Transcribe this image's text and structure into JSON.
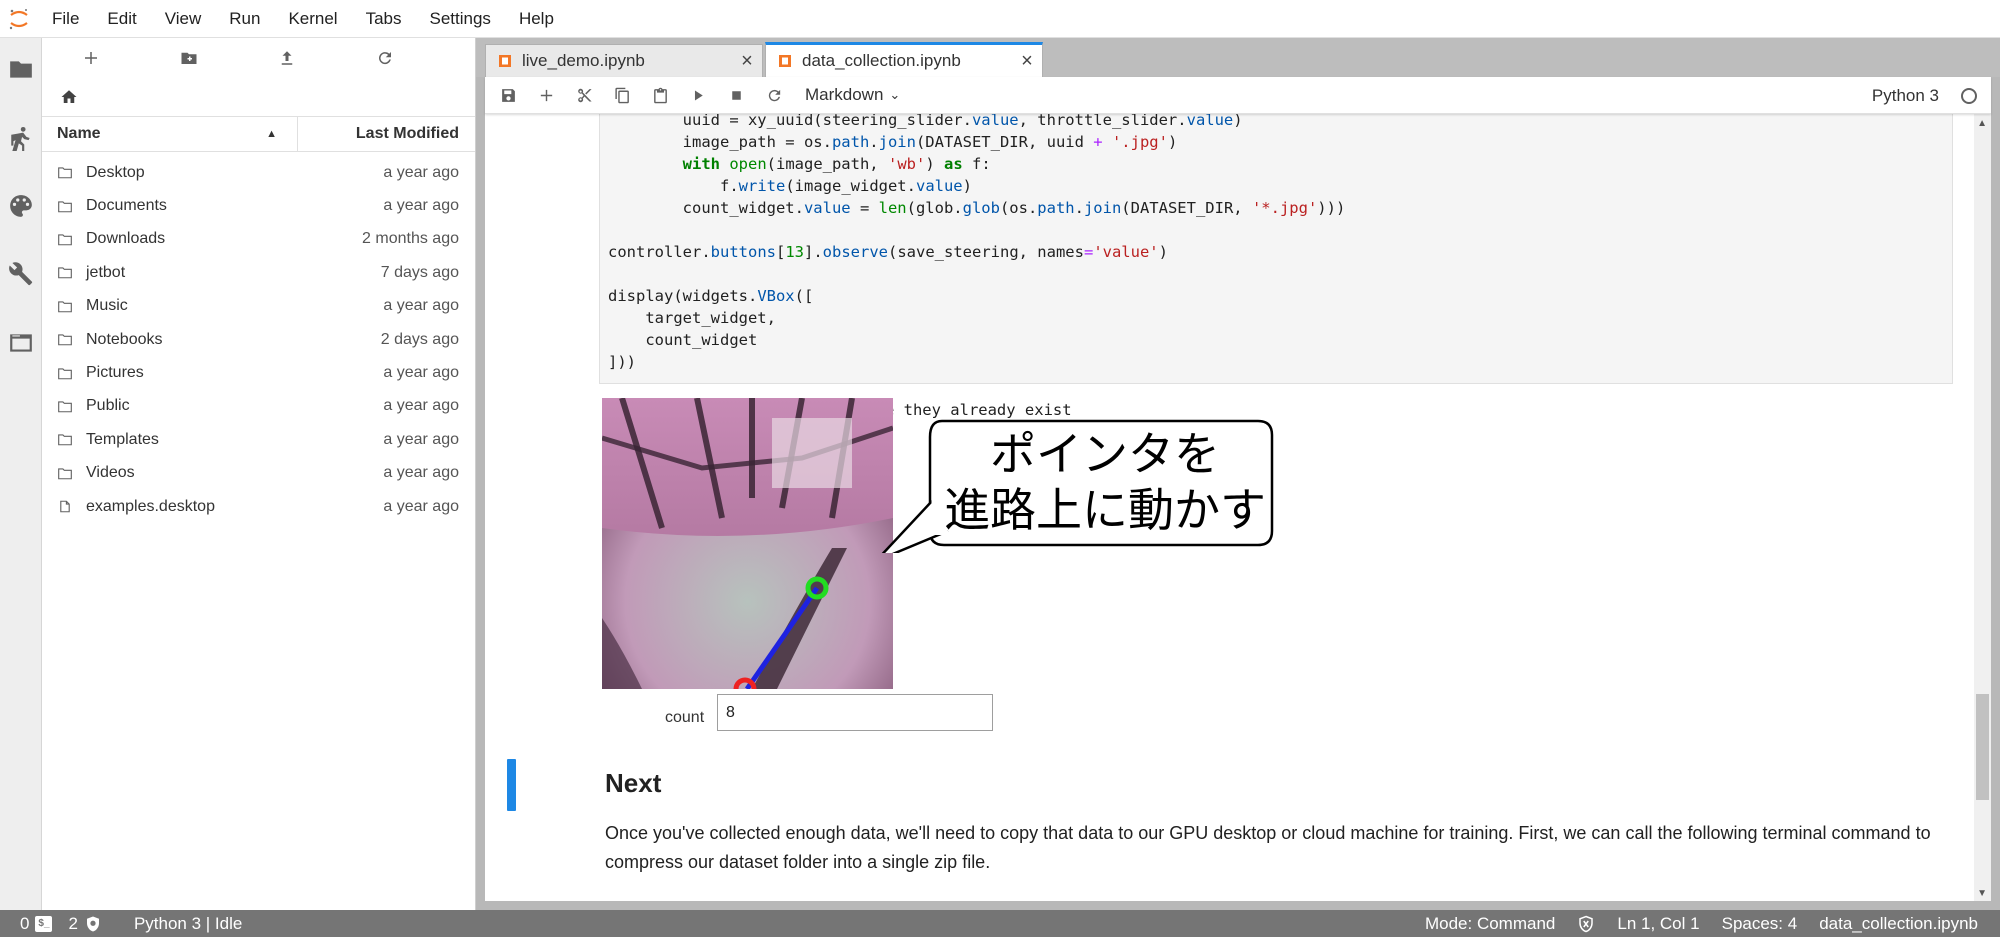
{
  "menu": [
    "File",
    "Edit",
    "View",
    "Run",
    "Kernel",
    "Tabs",
    "Settings",
    "Help"
  ],
  "file_browser": {
    "columns": {
      "name": "Name",
      "modified": "Last Modified"
    },
    "items": [
      {
        "name": "Desktop",
        "modified": "a year ago",
        "type": "folder"
      },
      {
        "name": "Documents",
        "modified": "a year ago",
        "type": "folder"
      },
      {
        "name": "Downloads",
        "modified": "2 months ago",
        "type": "folder"
      },
      {
        "name": "jetbot",
        "modified": "7 days ago",
        "type": "folder"
      },
      {
        "name": "Music",
        "modified": "a year ago",
        "type": "folder"
      },
      {
        "name": "Notebooks",
        "modified": "2 days ago",
        "type": "folder"
      },
      {
        "name": "Pictures",
        "modified": "a year ago",
        "type": "folder"
      },
      {
        "name": "Public",
        "modified": "a year ago",
        "type": "folder"
      },
      {
        "name": "Templates",
        "modified": "a year ago",
        "type": "folder"
      },
      {
        "name": "Videos",
        "modified": "a year ago",
        "type": "folder"
      },
      {
        "name": "examples.desktop",
        "modified": "a year ago",
        "type": "file"
      }
    ]
  },
  "tabs": [
    {
      "label": "live_demo.ipynb",
      "active": false
    },
    {
      "label": "data_collection.ipynb",
      "active": true
    }
  ],
  "notebook_toolbar": {
    "cell_type": "Markdown",
    "kernel": "Python 3"
  },
  "code_cell": {
    "lines": [
      "        uuid = xy_uuid(steering_slider.value, throttle_slider.value)",
      "        image_path = os.path.join(DATASET_DIR, uuid + '.jpg')",
      "        with open(image_path, 'wb') as f:",
      "            f.write(image_widget.value)",
      "        count_widget.value = len(glob.glob(os.path.join(DATASET_DIR, '*.jpg')))",
      "",
      "controller.buttons[13].observe(save_steering, names='value')",
      "",
      "display(widgets.VBox([",
      "    target_widget,",
      "    count_widget",
      "]))"
    ]
  },
  "output": {
    "text": "Directories not created becasue they already exist",
    "callout_line1": "ポインタを",
    "callout_line2": "進路上に動かす",
    "count_label": "count",
    "count_value": "8"
  },
  "markdown": {
    "heading": "Next",
    "paragraph": "Once you've collected enough data, we'll need to copy that data to our GPU desktop or cloud machine for training. First, we can call the following terminal command to compress our dataset folder into a single zip file."
  },
  "status_bar": {
    "count_a": "0",
    "count_b": "2",
    "kernel_status": "Python 3 | Idle",
    "mode": "Mode: Command",
    "position": "Ln 1, Col 1",
    "spaces": "Spaces: 4",
    "file": "data_collection.ipynb"
  },
  "colors": {
    "accent": "#1e88e5",
    "status_bar": "#757575",
    "jupyter_orange": "#f37726"
  }
}
